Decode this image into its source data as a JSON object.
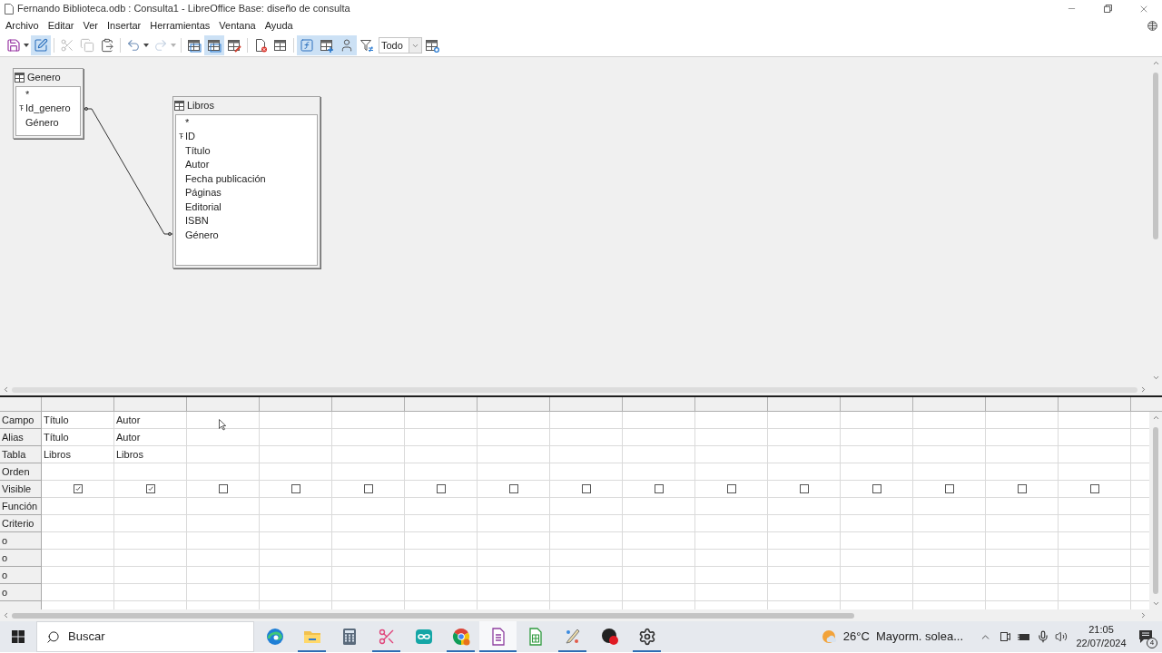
{
  "window": {
    "title": "Fernando Biblioteca.odb : Consulta1 - LibreOffice Base: diseño de consulta"
  },
  "menu": [
    "Archivo",
    "Editar",
    "Ver",
    "Insertar",
    "Herramientas",
    "Ventana",
    "Ayuda"
  ],
  "toolbar": [
    {
      "kind": "split",
      "selected": false,
      "disabled": false
    },
    {
      "kind": "button",
      "selected": true,
      "disabled": false
    },
    {
      "kind": "separator"
    },
    {
      "kind": "button",
      "selected": false,
      "disabled": true
    },
    {
      "kind": "button",
      "selected": false,
      "disabled": true
    },
    {
      "kind": "button",
      "selected": false,
      "disabled": false
    },
    {
      "kind": "separator"
    },
    {
      "kind": "split",
      "selected": false,
      "disabled": false
    },
    {
      "kind": "split",
      "selected": false,
      "disabled": true
    },
    {
      "kind": "separator"
    },
    {
      "kind": "button",
      "selected": false,
      "disabled": false
    },
    {
      "kind": "button",
      "selected": true,
      "disabled": false
    },
    {
      "kind": "button",
      "selected": false,
      "disabled": false
    },
    {
      "kind": "separator"
    },
    {
      "kind": "button",
      "selected": false,
      "disabled": false
    },
    {
      "kind": "button",
      "selected": false,
      "disabled": false
    },
    {
      "kind": "separator"
    },
    {
      "kind": "button",
      "selected": true,
      "disabled": false
    },
    {
      "kind": "button",
      "selected": true,
      "disabled": false
    },
    {
      "kind": "button",
      "selected": true,
      "disabled": false
    },
    {
      "kind": "button",
      "selected": false,
      "disabled": false
    },
    {
      "kind": "combo",
      "value": "Todo"
    },
    {
      "kind": "button",
      "selected": false,
      "disabled": false
    }
  ],
  "tables": [
    {
      "name": "Genero",
      "fields": [
        {
          "name": "*",
          "key": false
        },
        {
          "name": "Id_genero",
          "key": true
        },
        {
          "name": "Género",
          "key": false
        }
      ]
    },
    {
      "name": "Libros",
      "fields": [
        {
          "name": "*",
          "key": false
        },
        {
          "name": "ID",
          "key": true
        },
        {
          "name": "Título",
          "key": false
        },
        {
          "name": "Autor",
          "key": false
        },
        {
          "name": "Fecha publicación",
          "key": false
        },
        {
          "name": "Páginas",
          "key": false
        },
        {
          "name": "Editorial",
          "key": false
        },
        {
          "name": "ISBN",
          "key": false
        },
        {
          "name": "Género",
          "key": false
        }
      ]
    }
  ],
  "grid": {
    "rows": [
      {
        "label": "Campo",
        "kind": "field"
      },
      {
        "label": "Alias",
        "kind": "alias"
      },
      {
        "label": "Tabla",
        "kind": "table"
      },
      {
        "label": "Orden",
        "kind": "sort"
      },
      {
        "label": "Visible",
        "kind": "visible"
      },
      {
        "label": "Función",
        "kind": "function"
      },
      {
        "label": "Criterio",
        "kind": "criterion"
      },
      {
        "label": "o",
        "kind": "or"
      },
      {
        "label": "o",
        "kind": "or"
      },
      {
        "label": "o",
        "kind": "or"
      },
      {
        "label": "o",
        "kind": "or"
      }
    ],
    "columns": [
      {
        "field": "Título",
        "alias": "Título",
        "table": "Libros",
        "visible": true
      },
      {
        "field": "Autor",
        "alias": "Autor",
        "table": "Libros",
        "visible": true
      },
      {
        "visible": false
      },
      {
        "visible": false
      },
      {
        "visible": false
      },
      {
        "visible": false
      },
      {
        "visible": false
      },
      {
        "visible": false
      },
      {
        "visible": false
      },
      {
        "visible": false
      },
      {
        "visible": false
      },
      {
        "visible": false
      },
      {
        "visible": false
      },
      {
        "visible": false
      },
      {
        "visible": false
      }
    ]
  },
  "taskbar": {
    "search": {
      "placeholder": "Buscar"
    },
    "apps": [
      {
        "running": false,
        "selected": false
      },
      {
        "running": true,
        "selected": false
      },
      {
        "running": false,
        "selected": false
      },
      {
        "running": true,
        "selected": false
      },
      {
        "running": false,
        "selected": false
      },
      {
        "running": true,
        "selected": false
      },
      {
        "running": true,
        "selected": true
      },
      {
        "running": false,
        "selected": false
      },
      {
        "running": true,
        "selected": false
      },
      {
        "running": false,
        "selected": false
      },
      {
        "running": true,
        "selected": false
      }
    ],
    "weather": {
      "temperature": "26°C",
      "summary": "Mayorm. solea..."
    },
    "clock": {
      "time": "21:05",
      "date": "22/07/2024"
    },
    "notification_count": "4"
  }
}
